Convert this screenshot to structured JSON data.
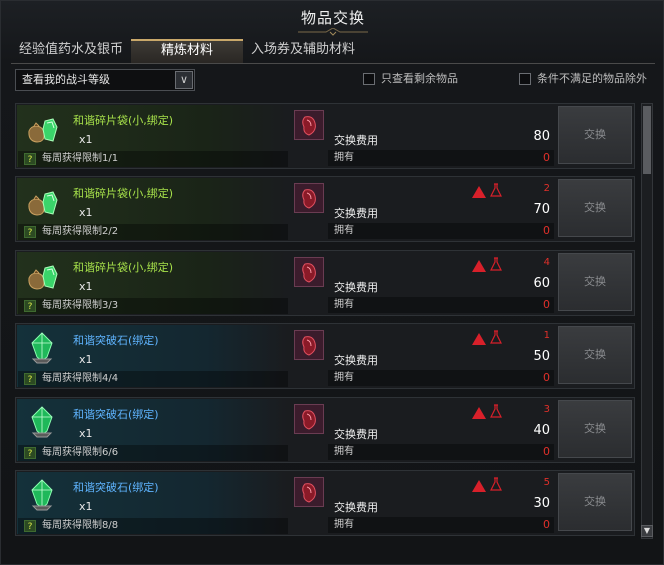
{
  "window": {
    "title": "物品交换"
  },
  "tabs": [
    {
      "label": "经验值药水及银币",
      "active": false
    },
    {
      "label": "精炼材料",
      "active": true
    },
    {
      "label": "入场券及辅助材料",
      "active": false
    }
  ],
  "filter": {
    "dropdown_value": "查看我的战斗等级",
    "check_remaining": "只查看剩余物品",
    "check_exclude": "条件不满足的物品除外"
  },
  "cost_label": "交换费用",
  "own_label": "拥有",
  "exchange_label": "交换",
  "items": [
    {
      "name": "和谐碎片袋(小,绑定)",
      "qty": "x1",
      "limit": "每周获得限制1/1",
      "cost": "80",
      "own": "0",
      "warn": "",
      "color_type": "green"
    },
    {
      "name": "和谐碎片袋(小,绑定)",
      "qty": "x1",
      "limit": "每周获得限制2/2",
      "cost": "70",
      "own": "0",
      "warn": "2",
      "color_type": "green"
    },
    {
      "name": "和谐碎片袋(小,绑定)",
      "qty": "x1",
      "limit": "每周获得限制3/3",
      "cost": "60",
      "own": "0",
      "warn": "4",
      "color_type": "green"
    },
    {
      "name": "和谐突破石(绑定)",
      "qty": "x1",
      "limit": "每周获得限制4/4",
      "cost": "50",
      "own": "0",
      "warn": "1",
      "color_type": "blue"
    },
    {
      "name": "和谐突破石(绑定)",
      "qty": "x1",
      "limit": "每周获得限制6/6",
      "cost": "40",
      "own": "0",
      "warn": "3",
      "color_type": "blue"
    },
    {
      "name": "和谐突破石(绑定)",
      "qty": "x1",
      "limit": "每周获得限制8/8",
      "cost": "30",
      "own": "0",
      "warn": "5",
      "color_type": "blue"
    }
  ],
  "colors": {
    "green_name": "#a6e04a",
    "blue_name": "#5fb4ff",
    "warn_red": "#e0302a",
    "tab_accent": "#c9a86a"
  }
}
